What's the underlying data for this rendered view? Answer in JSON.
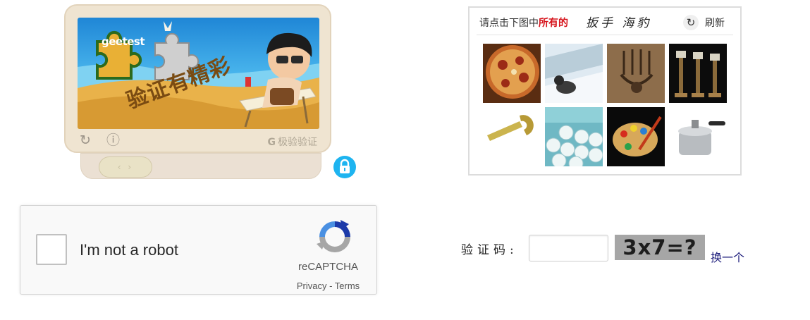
{
  "geetest": {
    "logo_text": "geetest",
    "image_caption": "验证有精彩",
    "refresh_icon": "refresh-icon",
    "info_icon": "info-icon",
    "brand_label": "极验验证",
    "slider_handle_glyph": "‹ ›",
    "lock_icon": "lock-icon",
    "colors": {
      "frame": "#efe4d1",
      "lock": "#1eb4f0"
    }
  },
  "image_select": {
    "instruction_prefix": "请点击下图中",
    "instruction_highlight": "所有的",
    "target_word": "扳手 海豹",
    "refresh_label": "刷新",
    "refresh_icon": "refresh-icon",
    "tiles": [
      {
        "name": "pizza"
      },
      {
        "name": "seal-on-ice"
      },
      {
        "name": "chandelier"
      },
      {
        "name": "candlesticks"
      },
      {
        "name": "wrench"
      },
      {
        "name": "pills"
      },
      {
        "name": "paint-palette"
      },
      {
        "name": "pressure-cooker"
      }
    ]
  },
  "recaptcha": {
    "checkbox_label": "I'm not a robot",
    "brand": "reCAPTCHA",
    "privacy": "Privacy",
    "separator": " - ",
    "terms": "Terms",
    "logo_icon": "recaptcha-logo-icon"
  },
  "math_captcha": {
    "label": "验证码:",
    "input_value": "",
    "image_text": "3x7=?",
    "switch_label": "换一个"
  }
}
